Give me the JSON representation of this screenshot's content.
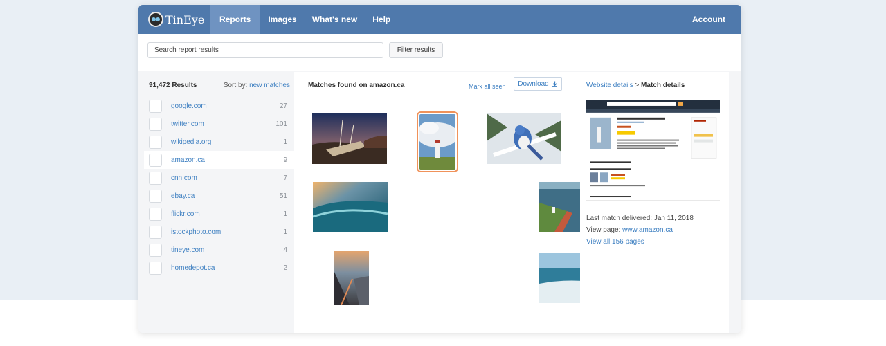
{
  "nav": {
    "logo": "TinEye",
    "items": [
      {
        "label": "Reports",
        "active": true
      },
      {
        "label": "Images"
      },
      {
        "label": "What's new"
      },
      {
        "label": "Help"
      }
    ],
    "account": "Account"
  },
  "search": {
    "placeholder": "Search report results",
    "filter_label": "Filter results"
  },
  "left": {
    "results": "91,472 Results",
    "sort_label": "Sort by:",
    "sort_value": "new matches",
    "domains": [
      {
        "name": "google.com",
        "count": "27"
      },
      {
        "name": "twitter.com",
        "count": "101"
      },
      {
        "name": "wikipedia.org",
        "count": "1"
      },
      {
        "name": "amazon.ca",
        "count": "9",
        "selected": true
      },
      {
        "name": "cnn.com",
        "count": "7"
      },
      {
        "name": "ebay.ca",
        "count": "51"
      },
      {
        "name": "flickr.com",
        "count": "1"
      },
      {
        "name": "istockphoto.com",
        "count": "1"
      },
      {
        "name": "tineye.com",
        "count": "4"
      },
      {
        "name": "homedepot.ca",
        "count": "2"
      }
    ]
  },
  "middle": {
    "title": "Matches found on amazon.ca",
    "mark_all": "Mark all seen",
    "download": "Download",
    "download_icon": "download-arrow-icon",
    "selected_index": 1
  },
  "right": {
    "crumb_link": "Website details",
    "crumb_sep": ">",
    "crumb_current": "Match details",
    "last_match_label": "Last match delivered:",
    "last_match_value": "Jan 11, 2018",
    "view_page_label": "View page:",
    "view_page_value": "www.amazon.ca",
    "view_all": "View all 156 pages"
  },
  "colors": {
    "nav": "#4f79ac",
    "nav_active": "#6f93c1",
    "link": "#3d7fc1",
    "selected_outline": "#f0925a"
  }
}
